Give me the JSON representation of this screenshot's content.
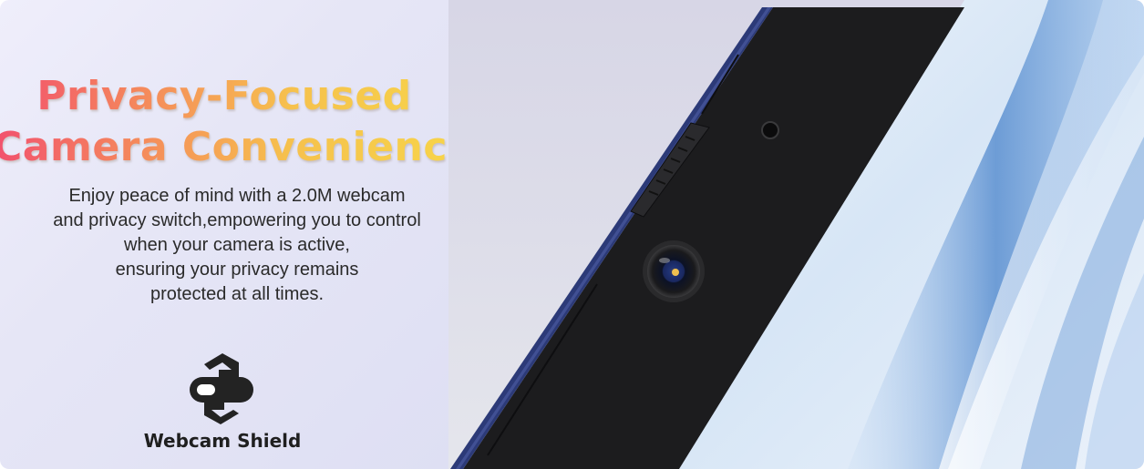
{
  "banner": {
    "headline_line1": "Privacy-Focused",
    "headline_line2": "Camera Convenience",
    "body_lines": [
      "Enjoy peace of mind with a 2.0M webcam",
      "and privacy switch,empowering you to control",
      "when your camera is active,",
      "ensuring your privacy remains",
      "protected at all times."
    ],
    "feature_label": "Webcam Shield",
    "feature_icon": "webcam-shield-icon"
  },
  "colors": {
    "headline_gradient_start": "#f2506e",
    "headline_gradient_end": "#f7d34a",
    "device_body": "#1c1c1e",
    "device_edge": "#2c3a78",
    "wallpaper_accent": "#5a8fd0"
  }
}
